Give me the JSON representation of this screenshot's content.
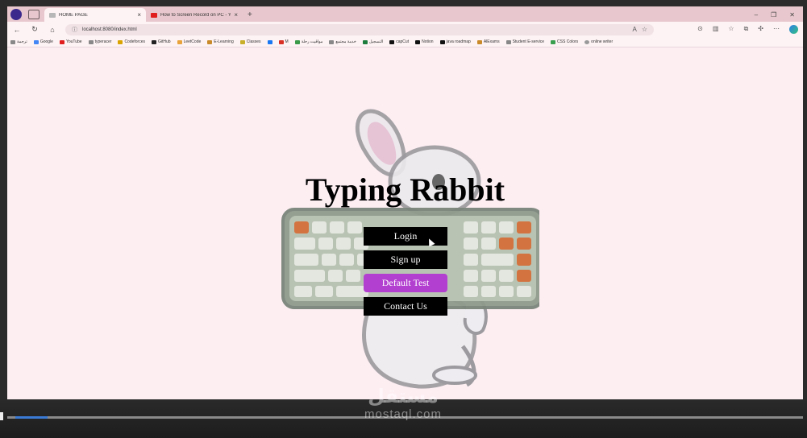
{
  "browser": {
    "tabs": [
      {
        "title": "HOME PAGE",
        "active": true
      },
      {
        "title": "How to Screen Record on PC - Y",
        "active": false
      }
    ],
    "url": "localhost:8080/index.html",
    "bookmarks": [
      "ترجمة",
      "Google",
      "YouTube",
      "typeracer",
      "Codeforces",
      "GitHub",
      "LeetCode",
      "E-Learning",
      "Classes",
      "M",
      "مواقيت رحلة",
      "خدمة مجتمع",
      "التسجيل",
      "capCut",
      "Notion",
      "java roadmap",
      "AlExams",
      "Student E-service",
      "CSS Colors",
      "online writer"
    ]
  },
  "page": {
    "title": "Typing Rabbit",
    "menu": [
      {
        "label": "Login",
        "highlighted": false
      },
      {
        "label": "Sign up",
        "highlighted": false
      },
      {
        "label": "Default Test",
        "highlighted": true
      },
      {
        "label": "Contact Us",
        "highlighted": false
      }
    ]
  },
  "watermark": {
    "arabic": "مستقل",
    "latin": "mostaql.com"
  },
  "colors": {
    "page_bg": "#fdeef2",
    "button_bg": "#000000",
    "button_highlight": "#b23fcf",
    "tabstrip": "#e8c8ce"
  }
}
